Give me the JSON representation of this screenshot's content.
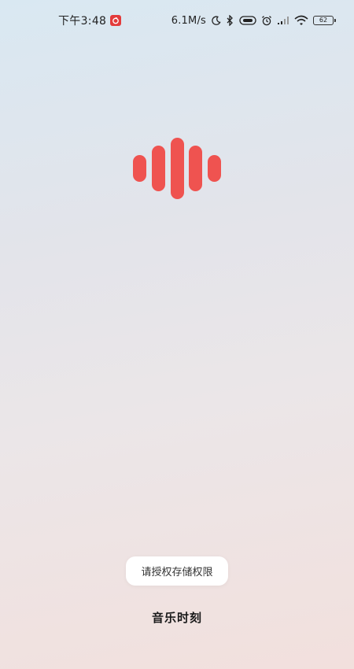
{
  "status_bar": {
    "time": "下午3:48",
    "app_badge_icon": "netease-music-icon",
    "net_speed": "6.1M/s",
    "icons": [
      "moon-icon",
      "bluetooth-icon",
      "hd-volte-icon",
      "alarm-icon",
      "signal-icon",
      "wifi-icon"
    ],
    "battery": "62"
  },
  "splash": {
    "logo_icon": "sound-wave-logo-icon",
    "logo_color": "#ef5350",
    "toast_message": "请授权存储权限",
    "app_name": "音乐时刻"
  }
}
